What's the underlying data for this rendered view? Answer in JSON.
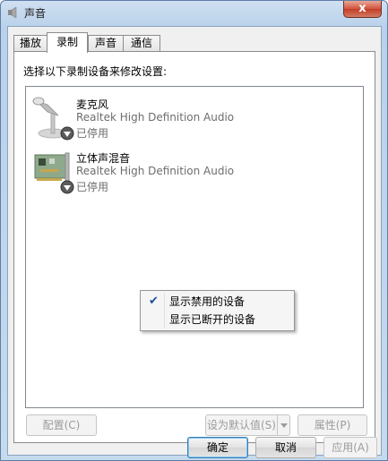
{
  "window": {
    "title": "声音",
    "close_label": "x"
  },
  "tabs": [
    {
      "label": "播放",
      "active": false
    },
    {
      "label": "录制",
      "active": true
    },
    {
      "label": "声音",
      "active": false
    },
    {
      "label": "通信",
      "active": false
    }
  ],
  "recording": {
    "instruction": "选择以下录制设备来修改设置:",
    "devices": [
      {
        "name": "麦克风",
        "driver": "Realtek High Definition Audio",
        "status": "已停用",
        "icon": "microphone-icon"
      },
      {
        "name": "立体声混音",
        "driver": "Realtek High Definition Audio",
        "status": "已停用",
        "icon": "sound-card-icon"
      }
    ]
  },
  "context_menu": {
    "items": [
      {
        "label": "显示禁用的设备",
        "checked": true
      },
      {
        "label": "显示已断开的设备",
        "checked": false
      }
    ]
  },
  "buttons": {
    "configure": "配置(C)",
    "set_default": "设为默认值(S)",
    "properties": "属性(P)",
    "ok": "确定",
    "cancel": "取消",
    "apply": "应用(A)"
  },
  "colors": {
    "title_bar": "#b9d1ea",
    "close_button": "#c33d27",
    "disabled_text": "#6d6d6d",
    "check_mark": "#1a4a9c"
  }
}
